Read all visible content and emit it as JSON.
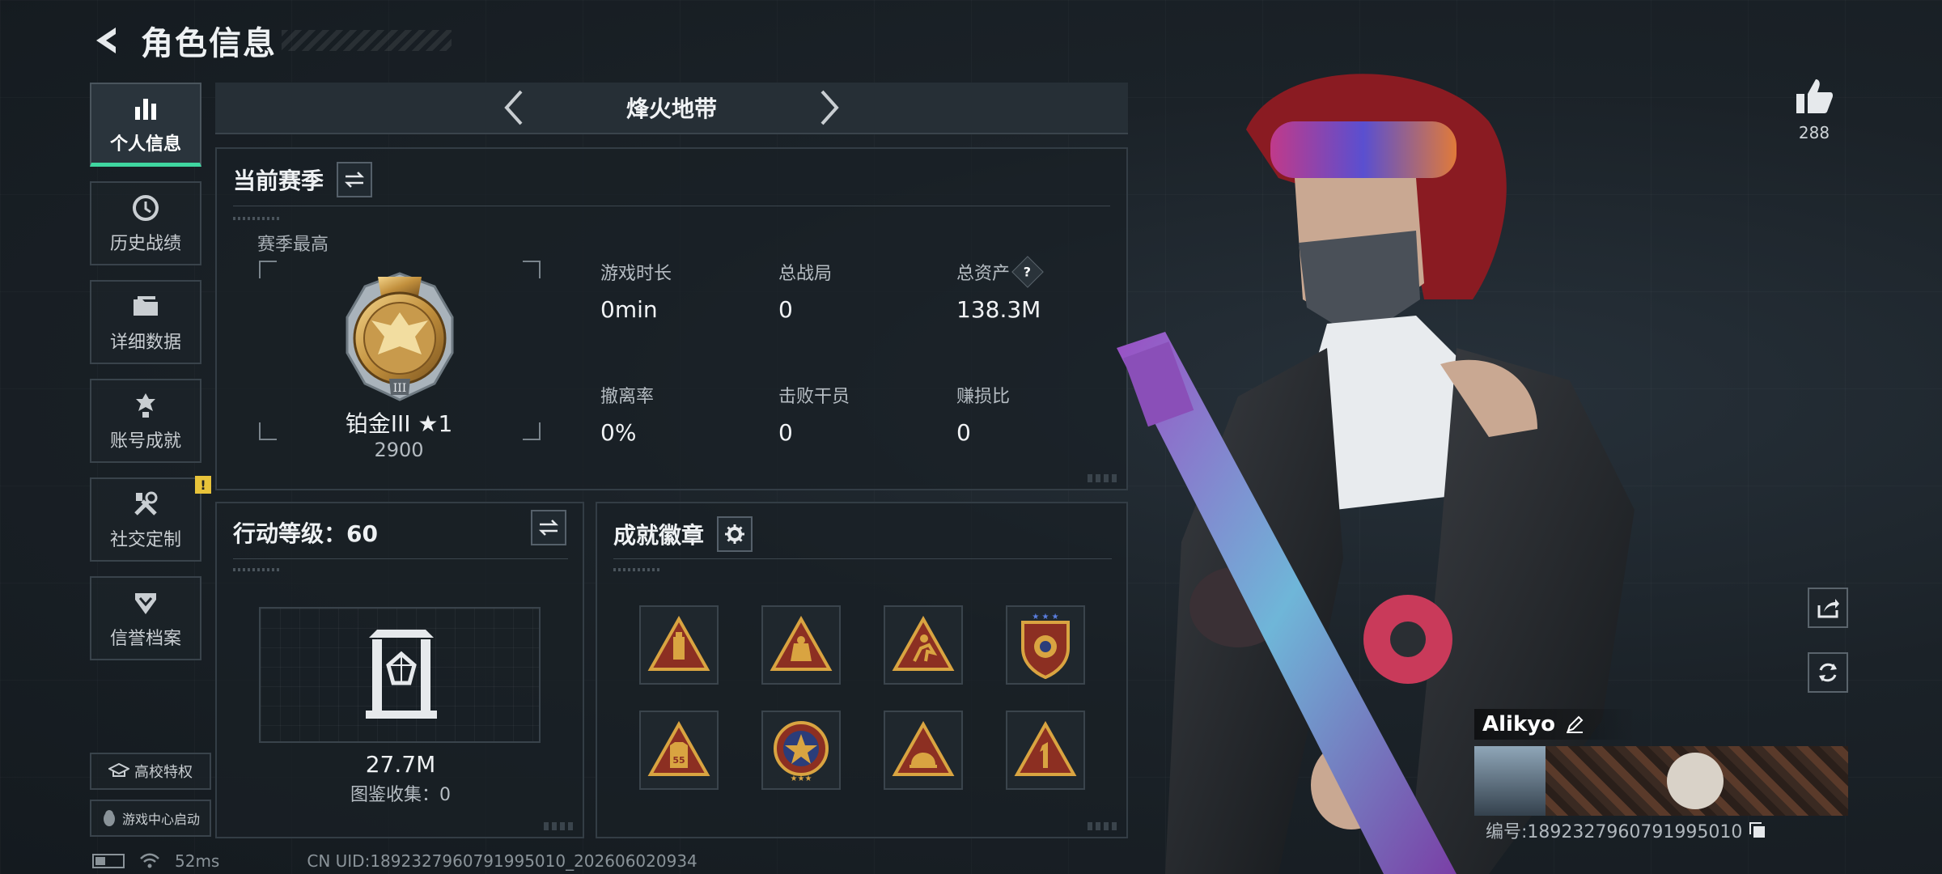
{
  "header": {
    "title": "角色信息"
  },
  "sidebar": {
    "items": [
      {
        "label": "个人信息",
        "icon": "bar-chart-icon",
        "active": true
      },
      {
        "label": "历史战绩",
        "icon": "history-icon"
      },
      {
        "label": "详细数据",
        "icon": "folder-icon"
      },
      {
        "label": "账号成就",
        "icon": "achievement-icon"
      },
      {
        "label": "社交定制",
        "icon": "tools-icon",
        "badge": "!"
      },
      {
        "label": "信誉档案",
        "icon": "credit-icon"
      }
    ],
    "campus_label": "高校特权",
    "game_center_label": "游戏中心启动"
  },
  "mode": {
    "name": "烽火地带"
  },
  "season": {
    "title": "当前赛季",
    "best_label": "赛季最高",
    "rank_name": "铂金III ★1",
    "rank_score": "2900",
    "stats": [
      {
        "label": "游戏时长",
        "value": "0min"
      },
      {
        "label": "总战局",
        "value": "0"
      },
      {
        "label": "总资产",
        "value": "138.3M",
        "help": "?"
      },
      {
        "label": "撤离率",
        "value": "0%"
      },
      {
        "label": "击败干员",
        "value": "0"
      },
      {
        "label": "赚损比",
        "value": "0"
      }
    ]
  },
  "level": {
    "title": "行动等级：60",
    "value": "27.7M",
    "caption": "图鉴收集：0"
  },
  "badges": {
    "title": "成就徽章",
    "items": [
      {
        "icon": "bottle-triangle-badge-icon"
      },
      {
        "icon": "bag-triangle-badge-icon"
      },
      {
        "icon": "runner-triangle-badge-icon"
      },
      {
        "icon": "shield-star-badge-icon"
      },
      {
        "icon": "vest-55-triangle-badge-icon"
      },
      {
        "icon": "star-medal-badge-icon"
      },
      {
        "icon": "helmet-triangle-badge-icon"
      },
      {
        "icon": "number-one-triangle-badge-icon"
      }
    ]
  },
  "likes": {
    "count": "288"
  },
  "player": {
    "name": "Alikyo",
    "uid_line": "编号:1892327960791995010"
  },
  "footer": {
    "ping": "52ms",
    "uid": "CN UID:1892327960791995010_202606020934"
  },
  "colors": {
    "accent": "#3fd6a0",
    "badge_gold": "#d9a441",
    "panel_border": "#333d45"
  }
}
